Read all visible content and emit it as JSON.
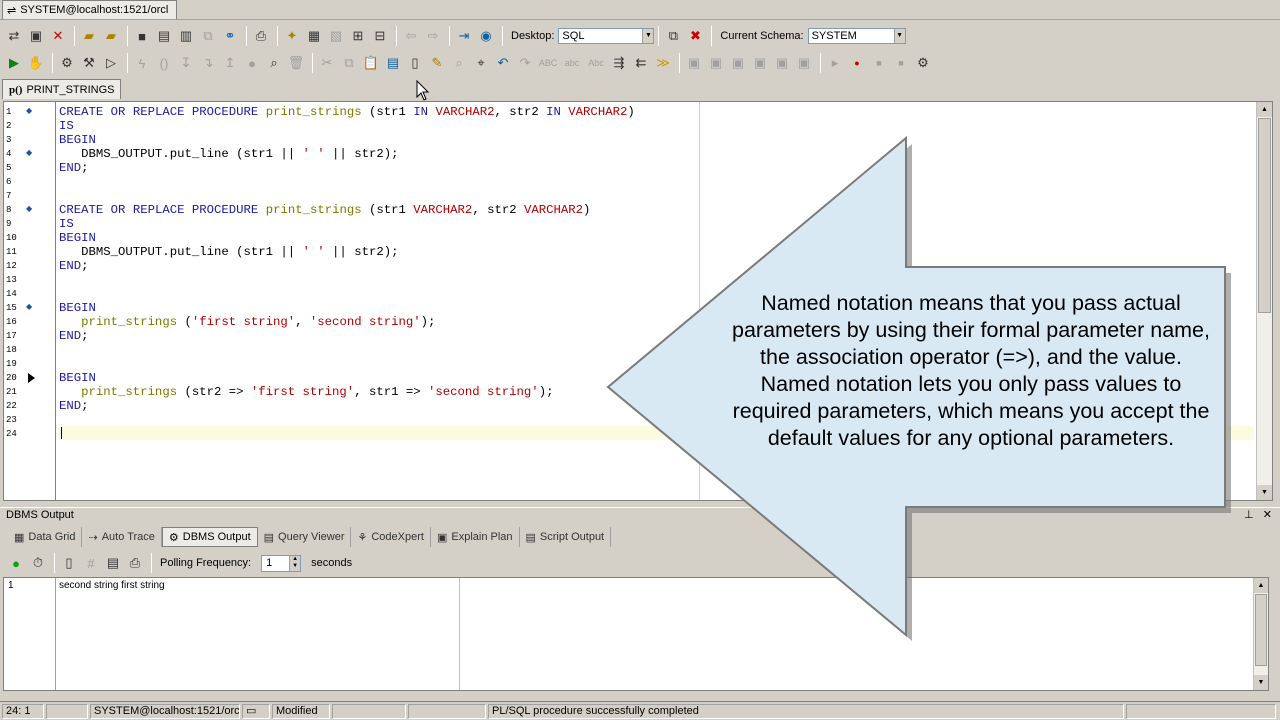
{
  "window": {
    "connection_tab": "SYSTEM@localhost:1521/orcl"
  },
  "toolbar": {
    "desktop_label": "Desktop:",
    "desktop_value": "SQL",
    "schema_label": "Current Schema:",
    "schema_value": "SYSTEM",
    "abc_buttons": [
      "ABC",
      "abc",
      "Abc"
    ]
  },
  "document_tab": {
    "prefix": "p()",
    "name": "PRINT_STRINGS"
  },
  "editor": {
    "line_numbers": [
      "1",
      "2",
      "3",
      "4",
      "5",
      "6",
      "7",
      "8",
      "9",
      "10",
      "11",
      "12",
      "13",
      "14",
      "15",
      "16",
      "17",
      "18",
      "19",
      "20",
      "21",
      "22",
      "23",
      "24"
    ],
    "lines": [
      "CREATE OR REPLACE PROCEDURE print_strings (str1 IN VARCHAR2, str2 IN VARCHAR2)",
      "IS",
      "BEGIN",
      "   DBMS_OUTPUT.put_line (str1 || ' ' || str2);",
      "END;",
      "",
      "",
      "CREATE OR REPLACE PROCEDURE print_strings (str1 VARCHAR2, str2 VARCHAR2)",
      "IS",
      "BEGIN",
      "   DBMS_OUTPUT.put_line (str1 || ' ' || str2);",
      "END;",
      "",
      "",
      "BEGIN",
      "   print_strings ('first string', 'second string');",
      "END;",
      "",
      "",
      "BEGIN",
      "   print_strings (str2 => 'first string', str1 => 'second string');",
      "END;",
      "",
      ""
    ]
  },
  "output_panel": {
    "title": "DBMS Output",
    "tabs": [
      "Data Grid",
      "Auto Trace",
      "DBMS Output",
      "Query Viewer",
      "CodeXpert",
      "Explain Plan",
      "Script Output"
    ],
    "active_tab": "DBMS Output",
    "polling_label": "Polling Frequency:",
    "polling_value": "1",
    "polling_unit": "seconds",
    "rows": [
      {
        "num": "1",
        "text": "second string first string"
      }
    ]
  },
  "status_bar": {
    "position": "24:  1",
    "connection": "SYSTEM@localhost:1521/orcl",
    "state": "Modified",
    "message": "PL/SQL procedure successfully completed"
  },
  "callout": {
    "text": "Named notation means that you pass actual parameters by using their formal parameter name, the association operator (=>), and the value. Named notation lets you only pass values to required parameters, which means you accept the default values for any optional parameters.",
    "fill": "#d9e9f3",
    "border": "#7a7a7a"
  }
}
